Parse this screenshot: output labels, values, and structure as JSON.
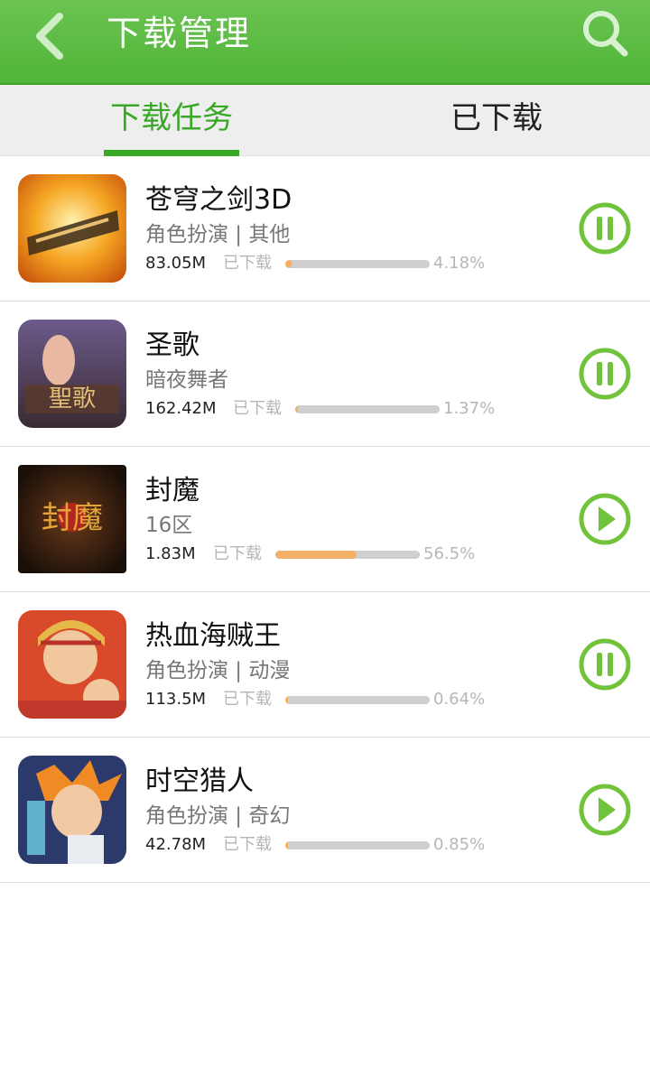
{
  "header": {
    "title": "下载管理",
    "back_icon": "back-arrow-icon",
    "search_icon": "search-icon"
  },
  "tabs": [
    {
      "label": "下载任务",
      "active": true
    },
    {
      "label": "已下载",
      "active": false
    }
  ],
  "colors": {
    "accent": "#4fb538",
    "progress_fill": "#f5b067",
    "progress_track": "#cfcfcf"
  },
  "downloads": [
    {
      "name": "苍穹之剑3D",
      "subtitle": "角色扮演 | 其他",
      "size": "83.05M",
      "status": "已下载",
      "percent": "4.18%",
      "progress": 0.0418,
      "action": "pause"
    },
    {
      "name": "圣歌",
      "subtitle": "暗夜舞者",
      "size": "162.42M",
      "status": "已下载",
      "percent": "1.37%",
      "progress": 0.0137,
      "action": "pause"
    },
    {
      "name": "封魔",
      "subtitle": "16区",
      "size": "1.83M",
      "status": "已下载",
      "percent": "56.5%",
      "progress": 0.565,
      "action": "play"
    },
    {
      "name": "热血海贼王",
      "subtitle": "角色扮演 | 动漫",
      "size": "113.5M",
      "status": "已下载",
      "percent": "0.64%",
      "progress": 0.0064,
      "action": "pause"
    },
    {
      "name": "时空猎人",
      "subtitle": "角色扮演 | 奇幻",
      "size": "42.78M",
      "status": "已下载",
      "percent": "0.85%",
      "progress": 0.0085,
      "action": "play"
    }
  ]
}
